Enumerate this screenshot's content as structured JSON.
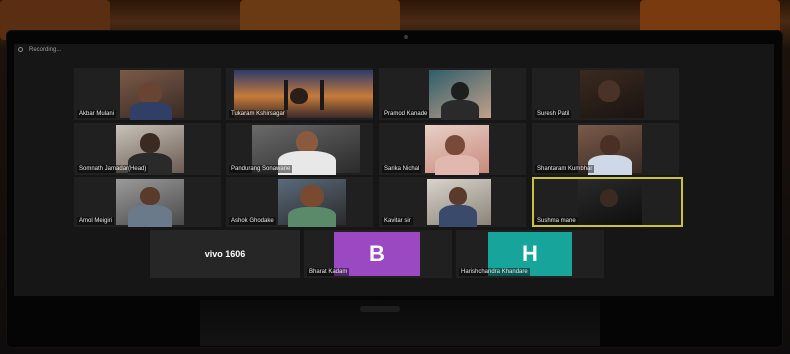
{
  "topbar": {
    "recording_text": "Recording..."
  },
  "gallery": {
    "row1": [
      {
        "name": "Akbar Mulani"
      },
      {
        "name": "Tukaram Kshirsagar"
      },
      {
        "name": "Pramod Kanade"
      },
      {
        "name": "Suresh Patil"
      }
    ],
    "row2": [
      {
        "name": "Somnath Jamadar(Head)"
      },
      {
        "name": "Pandurang Sonawane"
      },
      {
        "name": "Sarika Nichal"
      },
      {
        "name": "Shantaram Kumbhar"
      }
    ],
    "row3": [
      {
        "name": "Amol Meigiri"
      },
      {
        "name": "Ashok Ghodake"
      },
      {
        "name": "Kavitar sir"
      },
      {
        "name": "Sushma mane"
      }
    ],
    "row4": [
      {
        "label": "vivo 1606"
      },
      {
        "initial": "B",
        "name": "Bharat Kadam",
        "color": "#9a49c2"
      },
      {
        "initial": "H",
        "name": "Harishchandra Khandare",
        "color": "#17a49a"
      }
    ]
  },
  "colors": {
    "active_speaker_border": "#c9c23a"
  }
}
